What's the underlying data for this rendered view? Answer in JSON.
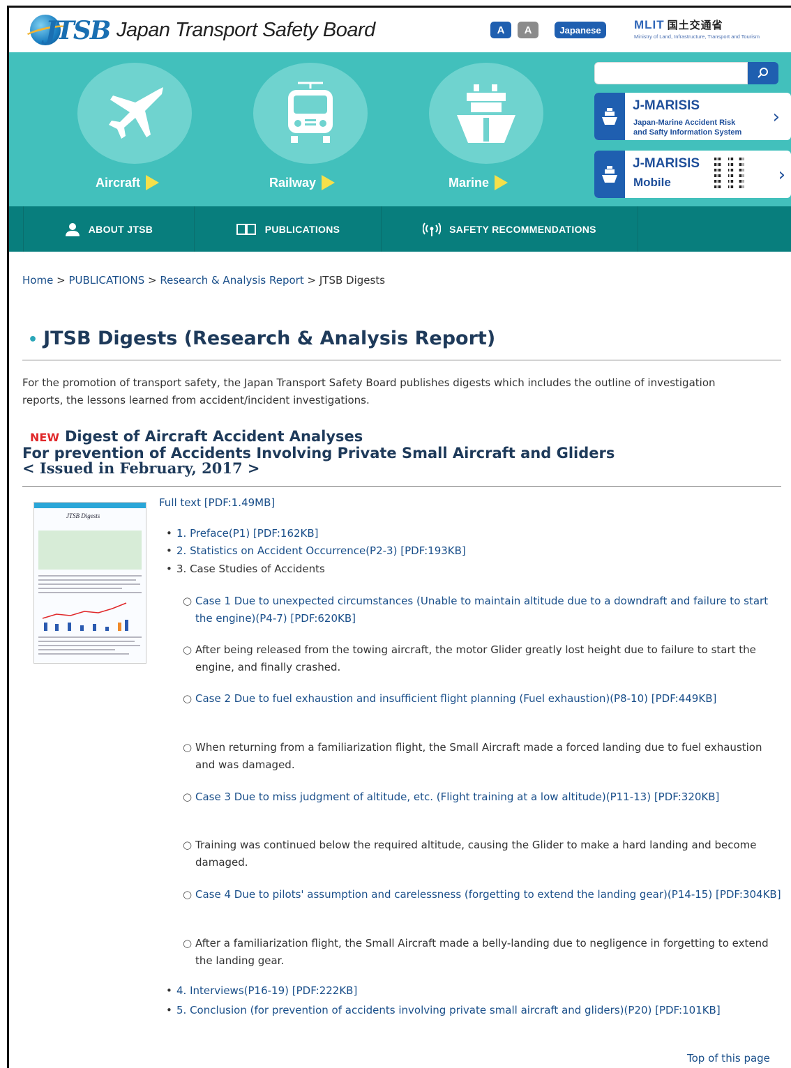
{
  "header": {
    "logo_letters": "JTSB",
    "logo_text": "Japan Transport Safety Board",
    "font_small_label": "A",
    "font_large_label": "A",
    "language_label": "Japanese",
    "mlit_logo": "MLIT",
    "mlit_jp": "国土交通省",
    "mlit_sub": "Ministry of Land, Infrastructure, Transport and Tourism"
  },
  "modes": [
    {
      "label": "Aircraft",
      "icon": "airplane-icon"
    },
    {
      "label": "Railway",
      "icon": "train-icon"
    },
    {
      "label": "Marine",
      "icon": "ship-icon"
    }
  ],
  "search": {
    "placeholder": ""
  },
  "marisis": {
    "title": "J-MARISIS",
    "subtitle_line1": "Japan-Marine Accident Risk",
    "subtitle_line2": "and Safty Information System",
    "mobile_title": "J-MARISIS",
    "mobile_label": "Mobile"
  },
  "nav": [
    {
      "label": "ABOUT JTSB",
      "icon": "person-icon"
    },
    {
      "label": "PUBLICATIONS",
      "icon": "book-icon"
    },
    {
      "label": "SAFETY RECOMMENDATIONS",
      "icon": "broadcast-icon"
    }
  ],
  "breadcrumb": {
    "home": "Home",
    "sep": ">",
    "publications": "PUBLICATIONS",
    "research": "Research & Analysis Report",
    "current": "JTSB Digests"
  },
  "page_title": "JTSB Digests (Research & Analysis Report)",
  "intro": "For the promotion of transport safety, the Japan Transport Safety Board publishes digests which includes the outline of investigation reports, the lessons learned from accident/incident investigations.",
  "digest": {
    "new_badge": "NEW",
    "line1": "Digest of Aircraft Accident Analyses",
    "line2": "For prevention of Accidents Involving Private Small Aircraft and Gliders",
    "line3": "< Issued in February, 2017 >",
    "thumb_title": "JTSB Digests",
    "full_text": "Full text [PDF:1.49MB]"
  },
  "toc": [
    "1. Preface(P1) [PDF:162KB]",
    "2. Statistics on Accident Occurrence(P2-3) [PDF:193KB]",
    "3. Case Studies of Accidents"
  ],
  "cases": [
    {
      "text": "Case 1 Due to unexpected circumstances (Unable to maintain altitude due to a downdraft and failure to start the engine)(P4-7) [PDF:620KB]",
      "link": true
    },
    {
      "text": "After being released from the towing aircraft, the motor Glider greatly lost height due to failure to start the engine, and finally crashed.",
      "link": false
    },
    {
      "text": "Case 2 Due to fuel exhaustion and insufficient flight planning (Fuel exhaustion)(P8-10) [PDF:449KB]",
      "link": true
    },
    {
      "text": "When returning from a familiarization flight, the Small Aircraft made a forced landing due to fuel exhaustion and was damaged.",
      "link": false
    },
    {
      "text": "Case 3 Due to miss judgment of altitude, etc. (Flight training at a low altitude)(P11-13) [PDF:320KB]",
      "link": true
    },
    {
      "text": "Training was continued below the required altitude, causing the Glider to make a hard landing and become damaged.",
      "link": false
    },
    {
      "text": "Case 4 Due to pilots' assumption and carelessness (forgetting to extend the landing gear)(P14-15) [PDF:304KB]",
      "link": true
    },
    {
      "text": "After a familiarization flight, the Small Aircraft made a belly-landing due to negligence in forgetting to extend the landing gear.",
      "link": false
    }
  ],
  "toc_tail": [
    "4. Interviews(P16-19) [PDF:222KB]",
    "5. Conclusion (for prevention of accidents involving private small aircraft and gliders)(P20) [PDF:101KB]"
  ],
  "top_link": "Top of this page",
  "colors": {
    "teal": "#42c0bc",
    "nav": "#087e7d",
    "link": "#1a4f8a",
    "accent_blue": "#1f5fb0",
    "new_red": "#e0282a"
  }
}
